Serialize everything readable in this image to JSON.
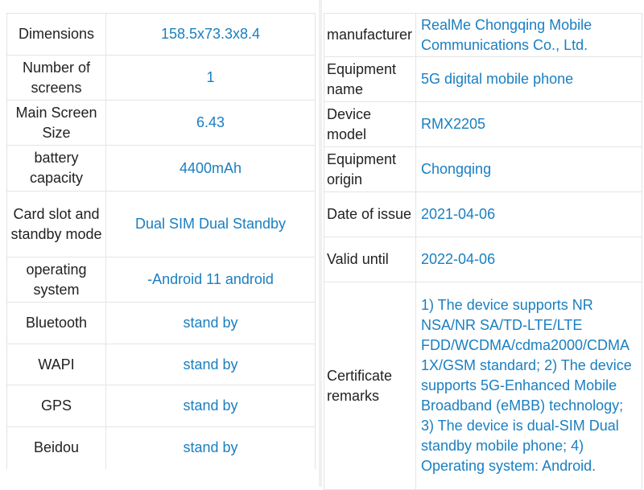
{
  "colors": {
    "label_text": "#222222",
    "value_text": "#1a7fc1",
    "border": "#e4e4e4"
  },
  "left_table": {
    "rows": [
      {
        "label": "Dimensions",
        "value": "158.5x73.3x8.4"
      },
      {
        "label": "Number of screens",
        "value": "1"
      },
      {
        "label": "Main Screen Size",
        "value": "6.43"
      },
      {
        "label": "battery capacity",
        "value": "4400mAh"
      },
      {
        "label": "Card slot and standby mode",
        "value": "Dual SIM Dual Standby"
      },
      {
        "label": "operating system",
        "value": "-Android 11 android"
      },
      {
        "label": "Bluetooth",
        "value": "stand by"
      },
      {
        "label": "WAPI",
        "value": "stand by"
      },
      {
        "label": "GPS",
        "value": "stand by"
      },
      {
        "label": "Beidou",
        "value": "stand by"
      }
    ]
  },
  "right_table": {
    "rows": [
      {
        "label": "manufacturer",
        "value": "RealMe Chongqing Mobile Communications Co., Ltd."
      },
      {
        "label": "Equipment name",
        "value": "5G digital mobile phone"
      },
      {
        "label": "Device model",
        "value": "RMX2205"
      },
      {
        "label": "Equipment origin",
        "value": "Chongqing"
      },
      {
        "label": "Date of issue",
        "value": "2021-04-06"
      },
      {
        "label": "Valid until",
        "value": "2022-04-06"
      },
      {
        "label": "Certificate remarks",
        "value": "1) The device supports NR NSA/NR SA/TD-LTE/LTE FDD/WCDMA/cdma2000/CDMA 1X/GSM standard; 2) The device supports 5G-Enhanced Mobile Broadband (eMBB) technology; 3) The device is dual-SIM Dual standby mobile phone; 4) Operating system: Android."
      }
    ]
  }
}
